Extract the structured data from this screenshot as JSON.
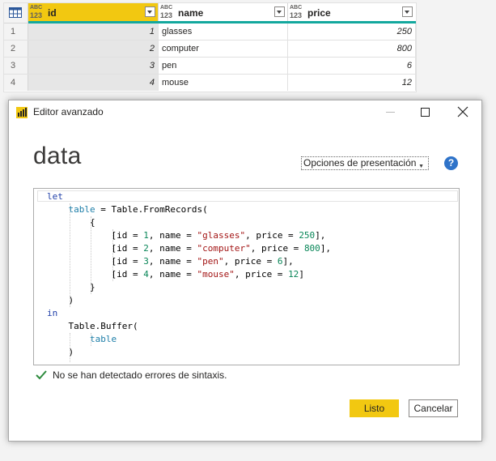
{
  "grid": {
    "columns": [
      {
        "type_top": "ABC",
        "type_bottom": "123",
        "title": "id"
      },
      {
        "type_top": "ABC",
        "type_bottom": "123",
        "title": "name"
      },
      {
        "type_top": "ABC",
        "type_bottom": "123",
        "title": "price"
      }
    ],
    "rows": [
      {
        "n": "1",
        "id": "1",
        "name": "glasses",
        "price": "250"
      },
      {
        "n": "2",
        "id": "2",
        "name": "computer",
        "price": "800"
      },
      {
        "n": "3",
        "id": "3",
        "name": "pen",
        "price": "6"
      },
      {
        "n": "4",
        "id": "4",
        "name": "mouse",
        "price": "12"
      }
    ],
    "selected_column_color": "#f2c811",
    "quality_bar_color": "#13a89e"
  },
  "dialog": {
    "title": "Editor avanzado",
    "query_name": "data",
    "display_options": "Opciones de presentación",
    "help_label": "?",
    "code": {
      "l1": "let",
      "l2_var": "table",
      "l2_rest": " = Table.FromRecords(",
      "l3": "{",
      "r1_a": "[id = ",
      "r1_id": "1",
      "r1_b": ", name = ",
      "r1_name": "\"glasses\"",
      "r1_c": ", price = ",
      "r1_price": "250",
      "r1_d": "],",
      "r2_a": "[id = ",
      "r2_id": "2",
      "r2_b": ", name = ",
      "r2_name": "\"computer\"",
      "r2_c": ", price = ",
      "r2_price": "800",
      "r2_d": "],",
      "r3_a": "[id = ",
      "r3_id": "3",
      "r3_b": ", name = ",
      "r3_name": "\"pen\"",
      "r3_c": ", price = ",
      "r3_price": "6",
      "r3_d": "],",
      "r4_a": "[id = ",
      "r4_id": "4",
      "r4_b": ", name = ",
      "r4_name": "\"mouse\"",
      "r4_c": ", price = ",
      "r4_price": "12",
      "r4_d": "]",
      "l8": "}",
      "l9": ")",
      "l10": "in",
      "l11": "Table.Buffer(",
      "l12": "table",
      "l13": ")"
    },
    "status": "No se han detectado errores de sintaxis.",
    "ok_label": "Listo",
    "cancel_label": "Cancelar",
    "accent_color": "#f2c811"
  }
}
